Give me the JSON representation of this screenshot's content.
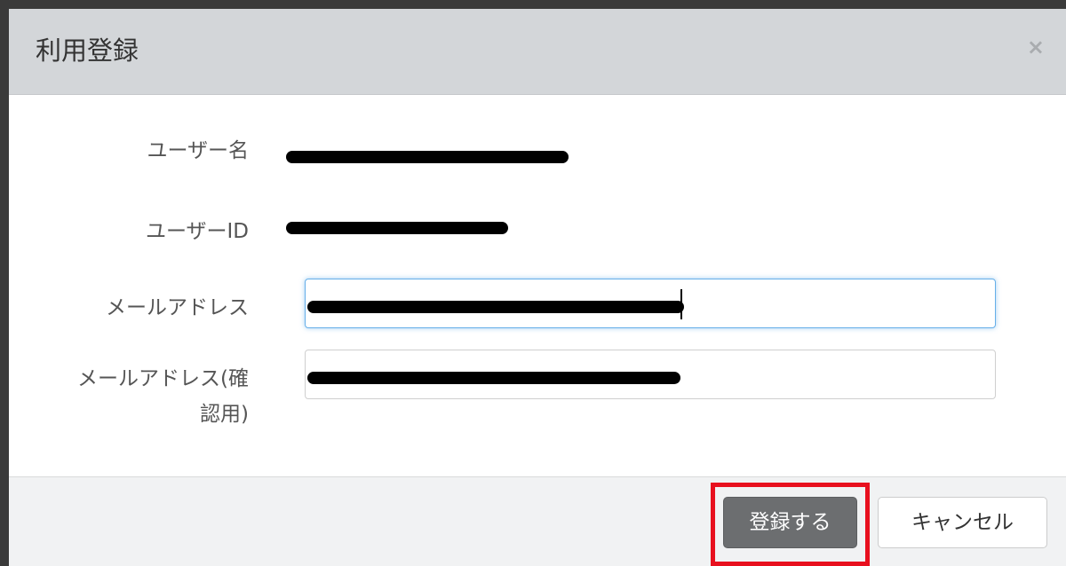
{
  "dialog": {
    "title": "利用登録",
    "close_glyph": "×",
    "close_icon": "close-icon"
  },
  "form": {
    "username_label": "ユーザー名",
    "userid_label": "ユーザーID",
    "email_label": "メールアドレス",
    "email_confirm_label_line1": "メールアドレス(確",
    "email_confirm_label_line2": "認用)",
    "username_value": "",
    "userid_value": "",
    "email_value": "",
    "email_confirm_value": ""
  },
  "footer": {
    "register_label": "登録する",
    "cancel_label": "キャンセル"
  },
  "colors": {
    "header_bg": "#d3d6d9",
    "primary_button": "#6c6e70",
    "highlight": "#e8101e",
    "focus_border": "#66afe9",
    "redaction": "#000000"
  }
}
